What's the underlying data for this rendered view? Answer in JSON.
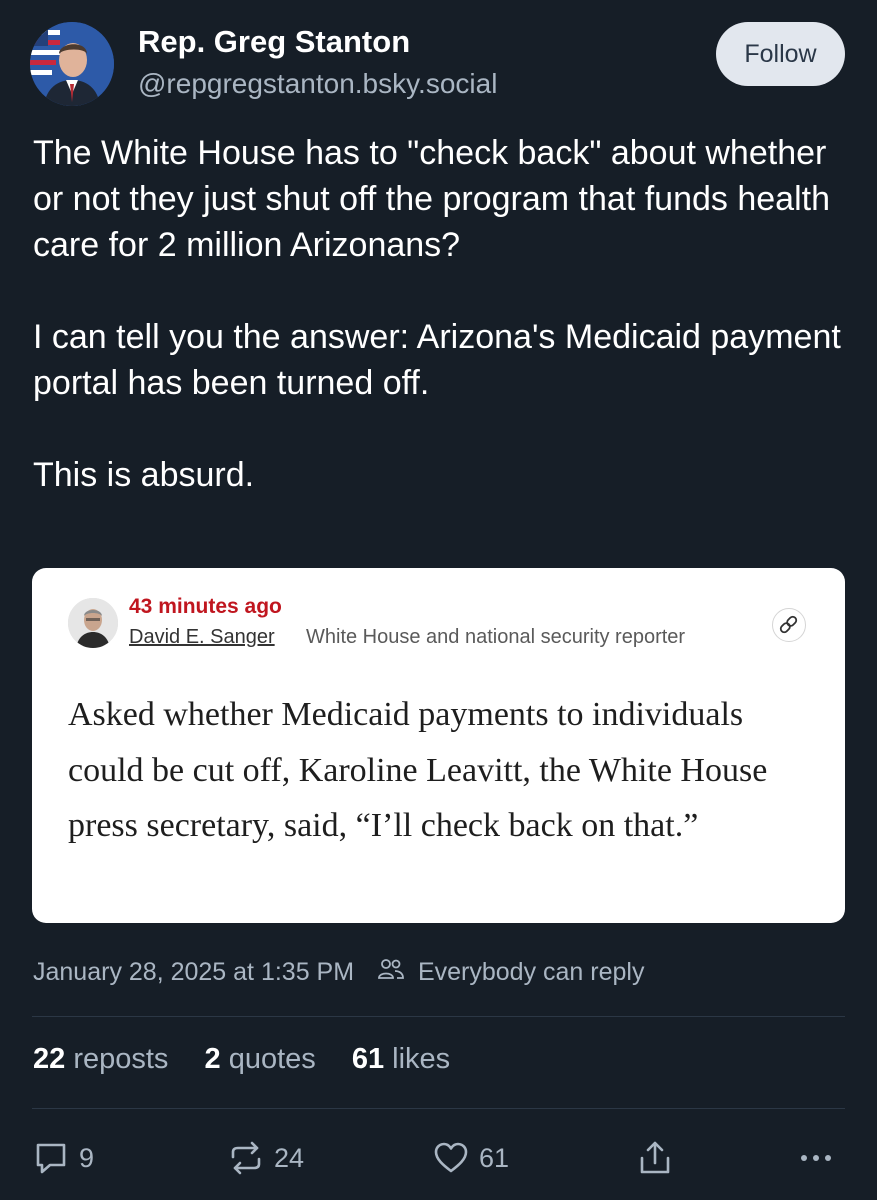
{
  "author": {
    "name": "Rep. Greg Stanton",
    "handle": "@repgregstanton.bsky.social",
    "follow_label": "Follow"
  },
  "post": {
    "paragraphs": [
      "The White House has to \"check back\" about whether or not they just shut off the program that funds health care for 2 million Arizonans?",
      "I can tell you the answer: Arizona's Medicaid payment portal has been turned off.",
      "This is absurd."
    ]
  },
  "embed": {
    "time_ago": "43 minutes ago",
    "reporter_name": "David E. Sanger",
    "reporter_role": "White House and national security reporter",
    "quote": "Asked whether Medicaid payments to individuals could be cut off, Karoline Leavitt, the White House press secretary, said, “I’ll check back on that.”",
    "link_icon": "link-icon"
  },
  "meta": {
    "date": "January 28, 2025 at 1:35 PM",
    "reply_setting": "Everybody can reply",
    "reply_icon": "people-icon"
  },
  "stats": {
    "reposts_count": "22",
    "reposts_label": "reposts",
    "quotes_count": "2",
    "quotes_label": "quotes",
    "likes_count": "61",
    "likes_label": "likes"
  },
  "actions": {
    "reply_count": "9",
    "repost_count": "24",
    "like_count": "61"
  },
  "colors": {
    "background": "#161e27",
    "muted_text": "#aab6c3",
    "follow_button_bg": "#e2e7ee",
    "timestamp_red": "#c0161f"
  }
}
